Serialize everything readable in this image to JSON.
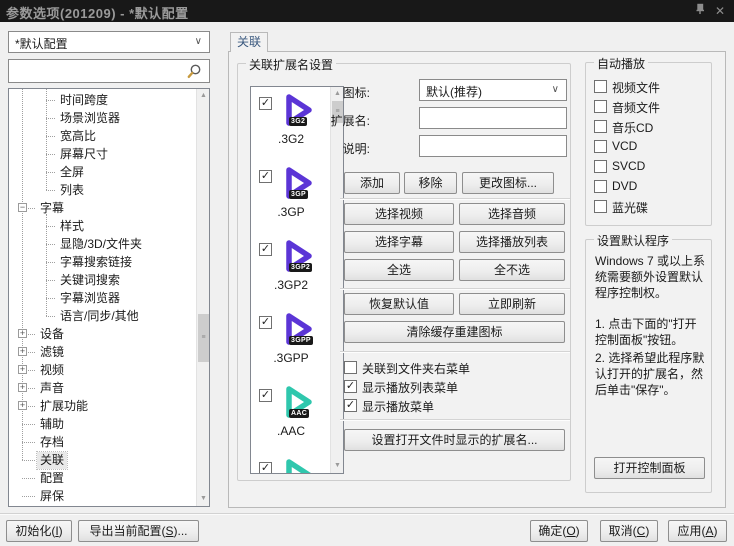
{
  "window": {
    "title": "参数选项(201209) - *默认配置"
  },
  "titlebar": {
    "pin_icon": "pin-icon",
    "close_glyph": "✕"
  },
  "profile": {
    "value": "*默认配置"
  },
  "search": {
    "value": ""
  },
  "tree": {
    "items": [
      {
        "label": "时间跨度",
        "depth": 2
      },
      {
        "label": "场景浏览器",
        "depth": 2
      },
      {
        "label": "宽高比",
        "depth": 2
      },
      {
        "label": "屏幕尺寸",
        "depth": 2
      },
      {
        "label": "全屏",
        "depth": 2
      },
      {
        "label": "列表",
        "depth": 2
      },
      {
        "label": "字幕",
        "depth": 1,
        "expander": "minus"
      },
      {
        "label": "样式",
        "depth": 2
      },
      {
        "label": "显隐/3D/文件夹",
        "depth": 2
      },
      {
        "label": "字幕搜索链接",
        "depth": 2
      },
      {
        "label": "关键词搜索",
        "depth": 2
      },
      {
        "label": "字幕浏览器",
        "depth": 2
      },
      {
        "label": "语言/同步/其他",
        "depth": 2
      },
      {
        "label": "设备",
        "depth": 1,
        "expander": "plus"
      },
      {
        "label": "滤镜",
        "depth": 1,
        "expander": "plus"
      },
      {
        "label": "视频",
        "depth": 1,
        "expander": "plus"
      },
      {
        "label": "声音",
        "depth": 1,
        "expander": "plus"
      },
      {
        "label": "扩展功能",
        "depth": 1,
        "expander": "plus"
      },
      {
        "label": "辅助",
        "depth": 1
      },
      {
        "label": "存档",
        "depth": 1
      },
      {
        "label": "关联",
        "depth": 1,
        "selected": true
      },
      {
        "label": "配置",
        "depth": 1
      },
      {
        "label": "屏保",
        "depth": 1
      }
    ]
  },
  "tab": {
    "label": "关联"
  },
  "assoc_group": {
    "title": "关联扩展名设置",
    "file_list": [
      {
        "ext": ".3G2",
        "badge": "3G2",
        "color": "#5b35d6",
        "checked": true
      },
      {
        "ext": ".3GP",
        "badge": "3GP",
        "color": "#5b35d6",
        "checked": true
      },
      {
        "ext": ".3GP2",
        "badge": "3GP2",
        "color": "#5b35d6",
        "checked": true
      },
      {
        "ext": ".3GPP",
        "badge": "3GPP",
        "color": "#5b35d6",
        "checked": true
      },
      {
        "ext": ".AAC",
        "badge": "AAC",
        "color": "#2fc7ad",
        "checked": true
      },
      {
        "ext": "",
        "badge": "",
        "color": "#2fc7ad",
        "checked": true,
        "partial": true
      }
    ],
    "fields": {
      "icon_label": "图标:",
      "icon_value": "默认(推荐)",
      "ext_label": "扩展名:",
      "ext_value": "",
      "desc_label": "说明:",
      "desc_value": ""
    },
    "buttons": {
      "add": "添加",
      "remove": "移除",
      "change_icon": "更改图标...",
      "select_video": "选择视频",
      "select_audio": "选择音频",
      "select_subtitle": "选择字幕",
      "select_playlist": "选择播放列表",
      "select_all": "全选",
      "select_none": "全不选",
      "restore_default": "恢复默认值",
      "refresh_now": "立即刷新",
      "clear_cache": "清除缓存重建图标",
      "set_open_ext": "设置打开文件时显示的扩展名..."
    },
    "checkboxes": [
      {
        "label": "关联到文件夹右菜单",
        "checked": false
      },
      {
        "label": "显示播放列表菜单",
        "checked": true
      },
      {
        "label": "显示播放菜单",
        "checked": true
      }
    ]
  },
  "autoplay_group": {
    "title": "自动播放",
    "checkboxes": [
      {
        "label": "视频文件",
        "checked": false
      },
      {
        "label": "音频文件",
        "checked": false
      },
      {
        "label": "音乐CD",
        "checked": false
      },
      {
        "label": "VCD",
        "checked": false
      },
      {
        "label": "SVCD",
        "checked": false
      },
      {
        "label": "DVD",
        "checked": false
      },
      {
        "label": "蓝光碟",
        "checked": false
      }
    ]
  },
  "default_program_group": {
    "title": "设置默认程序",
    "paragraphs": [
      "Windows 7 或以上系统需要额外设置默认程序控制权。",
      "1. 点击下面的\"打开控制面板\"按钮。",
      "2. 选择希望此程序默认打开的扩展名，然后单击\"保存\"。"
    ],
    "open_control_panel": "打开控制面板"
  },
  "footer": {
    "initialize": "初始化(I)",
    "export_config": "导出当前配置(S)...",
    "ok": "确定(O)",
    "cancel": "取消(C)",
    "apply": "应用(A)"
  },
  "colors": {
    "purple": "#5b35d6",
    "teal": "#2fc7ad",
    "badge_bg": "#191919"
  }
}
